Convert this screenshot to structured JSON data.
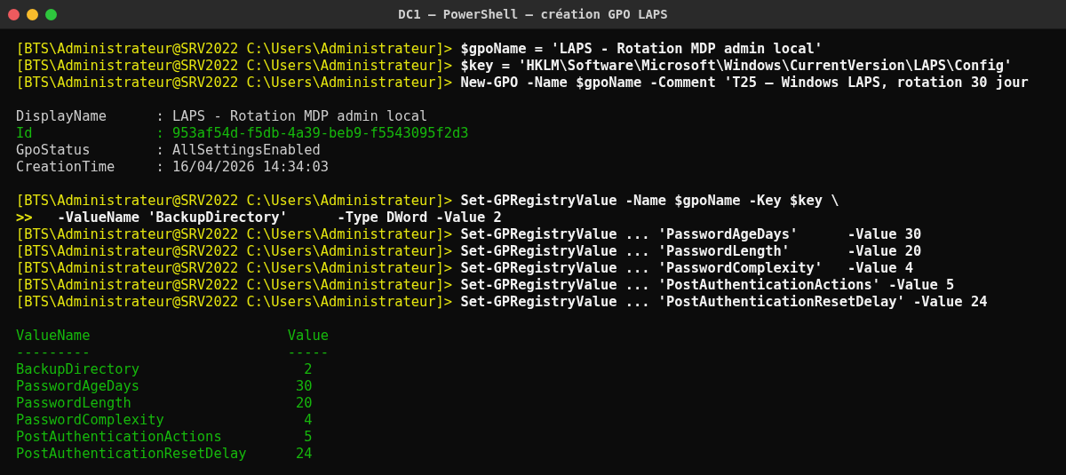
{
  "window": {
    "title": "DC1 — PowerShell — création GPO LAPS",
    "buttons": [
      {
        "color": "#ed5a5e"
      },
      {
        "color": "#f7bb2c"
      },
      {
        "color": "#2ec53d"
      }
    ]
  },
  "commands_1": [
    {
      "kind": "prompt",
      "prompt": "[BTS\\Administrateur@SRV2022 C:\\Users\\Administrateur]>",
      "command": "$gpoName = 'LAPS - Rotation MDP admin local'"
    },
    {
      "kind": "prompt",
      "prompt": "[BTS\\Administrateur@SRV2022 C:\\Users\\Administrateur]>",
      "command": "$key = 'HKLM\\Software\\Microsoft\\Windows\\CurrentVersion\\LAPS\\Config'"
    },
    {
      "kind": "prompt",
      "prompt": "[BTS\\Administrateur@SRV2022 C:\\Users\\Administrateur]>",
      "command": "New-GPO -Name $gpoName -Comment 'T25 — Windows LAPS, rotation 30 jour"
    }
  ],
  "gpo_output": [
    {
      "name": "DisplayName",
      "value": ": LAPS - Rotation MDP admin local",
      "color": "#cccccc"
    },
    {
      "name": "Id",
      "value": ": 953af54d-f5db-4a39-beb9-f5543095f2d3",
      "color": "#16b80c"
    },
    {
      "name": "GpoStatus",
      "value": ": AllSettingsEnabled",
      "color": "#cccccc"
    },
    {
      "name": "CreationTime",
      "value": ": 16/04/2026 14:34:03",
      "color": "#cccccc"
    }
  ],
  "commands_2": [
    {
      "kind": "prompt",
      "prompt": "[BTS\\Administrateur@SRV2022 C:\\Users\\Administrateur]>",
      "command": "Set-GPRegistryValue -Name $gpoName -Key $key \\"
    },
    {
      "kind": "continuation",
      "prompt": ">>",
      "command": "  -ValueName 'BackupDirectory'      -Type DWord -Value 2"
    },
    {
      "kind": "prompt",
      "prompt": "[BTS\\Administrateur@SRV2022 C:\\Users\\Administrateur]>",
      "command": "Set-GPRegistryValue ... 'PasswordAgeDays'      -Value 30"
    },
    {
      "kind": "prompt",
      "prompt": "[BTS\\Administrateur@SRV2022 C:\\Users\\Administrateur]>",
      "command": "Set-GPRegistryValue ... 'PasswordLength'       -Value 20"
    },
    {
      "kind": "prompt",
      "prompt": "[BTS\\Administrateur@SRV2022 C:\\Users\\Administrateur]>",
      "command": "Set-GPRegistryValue ... 'PasswordComplexity'   -Value 4"
    },
    {
      "kind": "prompt",
      "prompt": "[BTS\\Administrateur@SRV2022 C:\\Users\\Administrateur]>",
      "command": "Set-GPRegistryValue ... 'PostAuthenticationActions' -Value 5"
    },
    {
      "kind": "prompt",
      "prompt": "[BTS\\Administrateur@SRV2022 C:\\Users\\Administrateur]>",
      "command": "Set-GPRegistryValue ... 'PostAuthenticationResetDelay' -Value 24"
    }
  ],
  "result_table": {
    "columns": [
      {
        "label": "ValueName",
        "underline": "---------"
      },
      {
        "label": "Value",
        "underline": "-----"
      }
    ],
    "rows": [
      {
        "value_name": "BackupDirectory",
        "value": "2"
      },
      {
        "value_name": "PasswordAgeDays",
        "value": "30"
      },
      {
        "value_name": "PasswordLength",
        "value": "20"
      },
      {
        "value_name": "PasswordComplexity",
        "value": "4"
      },
      {
        "value_name": "PostAuthenticationActions",
        "value": "5"
      },
      {
        "value_name": "PostAuthenticationResetDelay",
        "value": "24"
      }
    ]
  }
}
